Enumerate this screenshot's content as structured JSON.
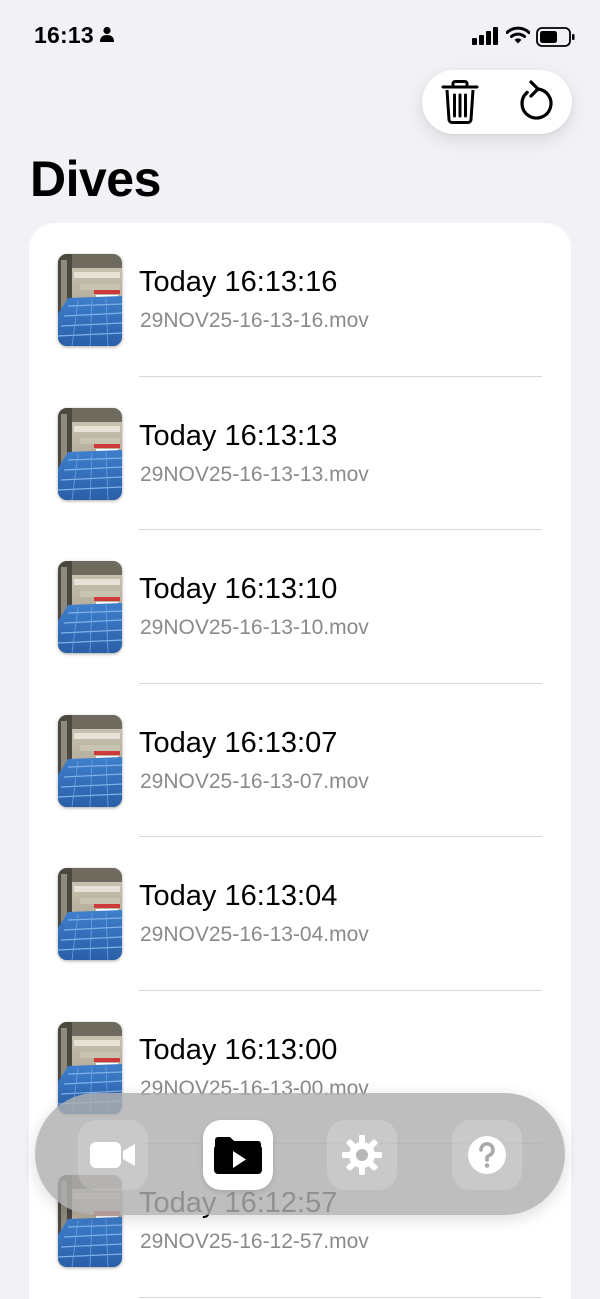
{
  "status_bar": {
    "time": "16:13"
  },
  "header": {
    "title": "Dives"
  },
  "toolbar": {
    "delete_icon": "trash-icon",
    "refresh_icon": "refresh-icon"
  },
  "dives": [
    {
      "title": "Today 16:13:16",
      "filename": "29NOV25-16-13-16.mov"
    },
    {
      "title": "Today 16:13:13",
      "filename": "29NOV25-16-13-13.mov"
    },
    {
      "title": "Today 16:13:10",
      "filename": "29NOV25-16-13-10.mov"
    },
    {
      "title": "Today 16:13:07",
      "filename": "29NOV25-16-13-07.mov"
    },
    {
      "title": "Today 16:13:04",
      "filename": "29NOV25-16-13-04.mov"
    },
    {
      "title": "Today 16:13:00",
      "filename": "29NOV25-16-13-00.mov"
    },
    {
      "title": "Today 16:12:57",
      "filename": "29NOV25-16-12-57.mov"
    }
  ],
  "tab_bar": {
    "tabs": [
      {
        "icon": "video-camera-icon",
        "selected": false
      },
      {
        "icon": "play-folder-icon",
        "selected": true
      },
      {
        "icon": "gear-icon",
        "selected": false
      },
      {
        "icon": "question-icon",
        "selected": false
      }
    ]
  },
  "colors": {
    "background": "#f2f1f6",
    "card": "#ffffff",
    "secondary_text": "#8a8a8e",
    "tab_bar": "#b0b0b0"
  }
}
